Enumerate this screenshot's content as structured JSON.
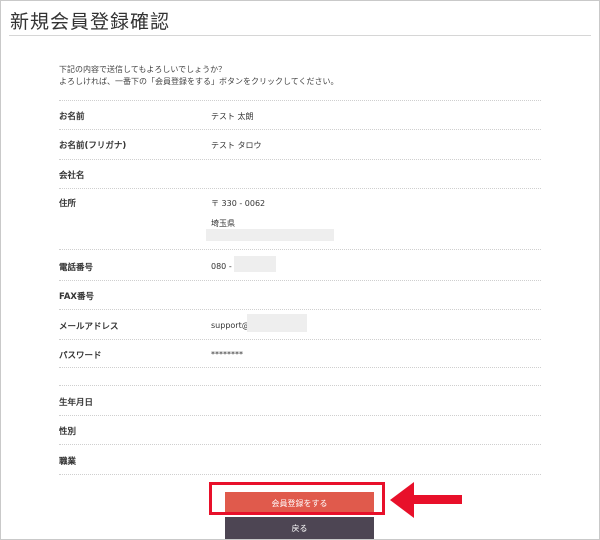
{
  "page": {
    "title": "新規会員登録確認",
    "intro_line1": "下記の内容で送信してもよろしいでしょうか？",
    "intro_line2": "よろしければ、一番下の「会員登録をする」ボタンをクリックしてください。"
  },
  "fields": {
    "name": {
      "label": "お名前",
      "value": "テスト 太朗"
    },
    "name_kana": {
      "label": "お名前(フリガナ)",
      "value": "テスト タロウ"
    },
    "company": {
      "label": "会社名",
      "value": ""
    },
    "address": {
      "label": "住所",
      "postal": "〒 330 - 0062",
      "prefecture": "埼玉県"
    },
    "phone": {
      "label": "電話番号",
      "value": "080 -"
    },
    "fax": {
      "label": "FAX番号",
      "value": ""
    },
    "email": {
      "label": "メールアドレス",
      "value": "support@"
    },
    "password": {
      "label": "パスワード",
      "value": "********"
    },
    "birthday": {
      "label": "生年月日",
      "value": ""
    },
    "gender": {
      "label": "性別",
      "value": ""
    },
    "occupation": {
      "label": "職業",
      "value": ""
    }
  },
  "actions": {
    "submit_label": "会員登録をする",
    "back_label": "戻る"
  },
  "annotation": {
    "highlight_color": "#e8102a",
    "arrow_icon": "left-arrow-icon"
  },
  "colors": {
    "submit_bg": "#e05a4c",
    "back_bg": "#4d4553"
  }
}
